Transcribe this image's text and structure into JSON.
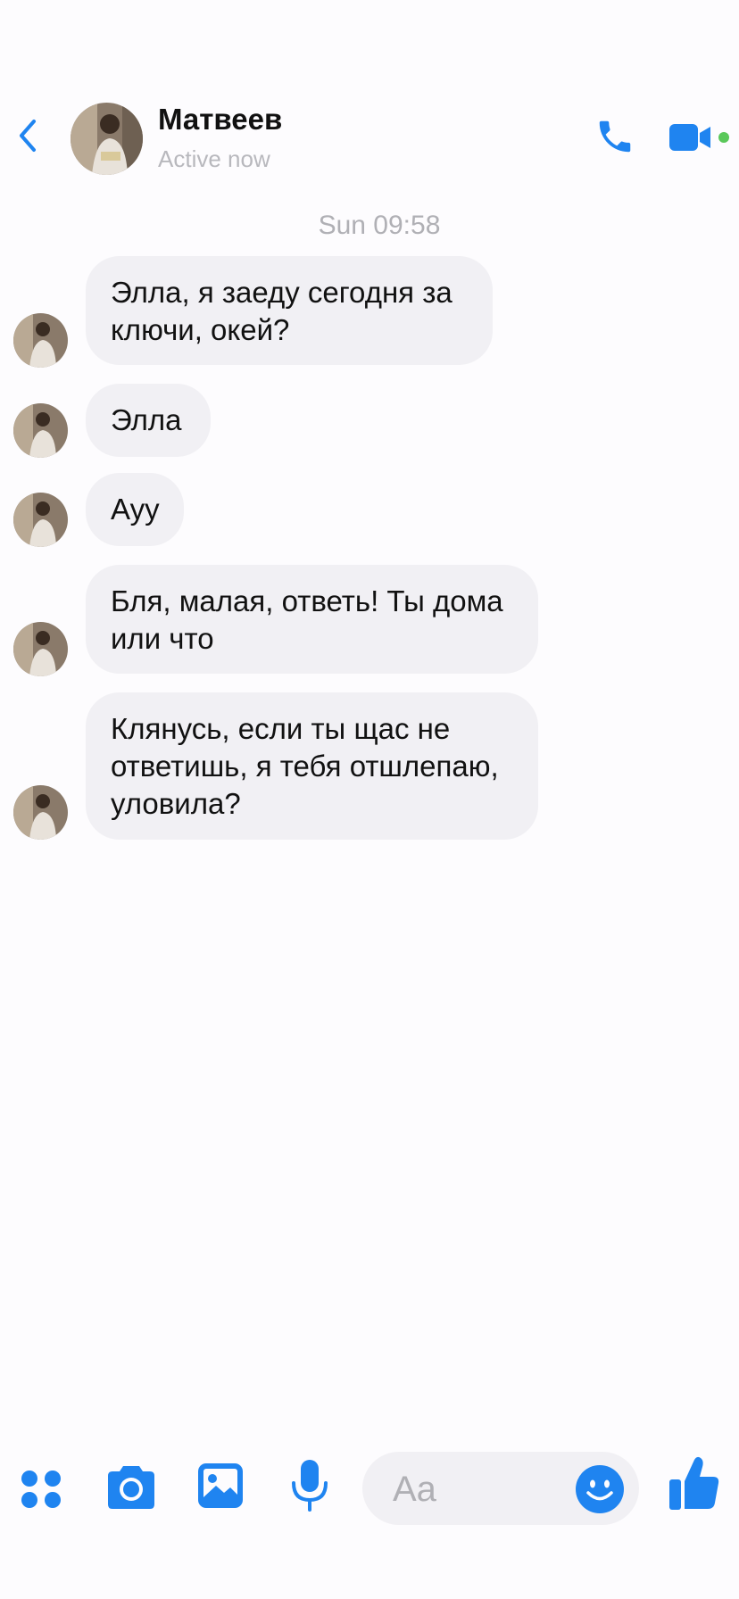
{
  "header": {
    "contact_name": "Матвеев",
    "status": "Active now"
  },
  "conversation": {
    "timestamp": "Sun 09:58",
    "messages": [
      {
        "line1": "Элла, я заеду сегодня за",
        "line2": "ключи, окей?"
      },
      {
        "line1": "Элла"
      },
      {
        "line1": "Ауу"
      },
      {
        "line1": "Бля, малая, ответь! Ты дома",
        "line2": "или что"
      },
      {
        "line1": "Клянусь, если ты щас не",
        "line2": "ответишь, я тебя отшлепаю,",
        "line3": "уловила?"
      }
    ]
  },
  "composer": {
    "placeholder": "Aa"
  },
  "colors": {
    "accent": "#1f84f0",
    "bubble": "#f1f0f4",
    "online": "#5ac85a"
  },
  "icons": [
    "back-chevron-icon",
    "phone-icon",
    "video-camera-icon",
    "apps-grid-icon",
    "camera-icon",
    "photo-icon",
    "microphone-icon",
    "emoji-icon",
    "thumbs-up-icon"
  ]
}
